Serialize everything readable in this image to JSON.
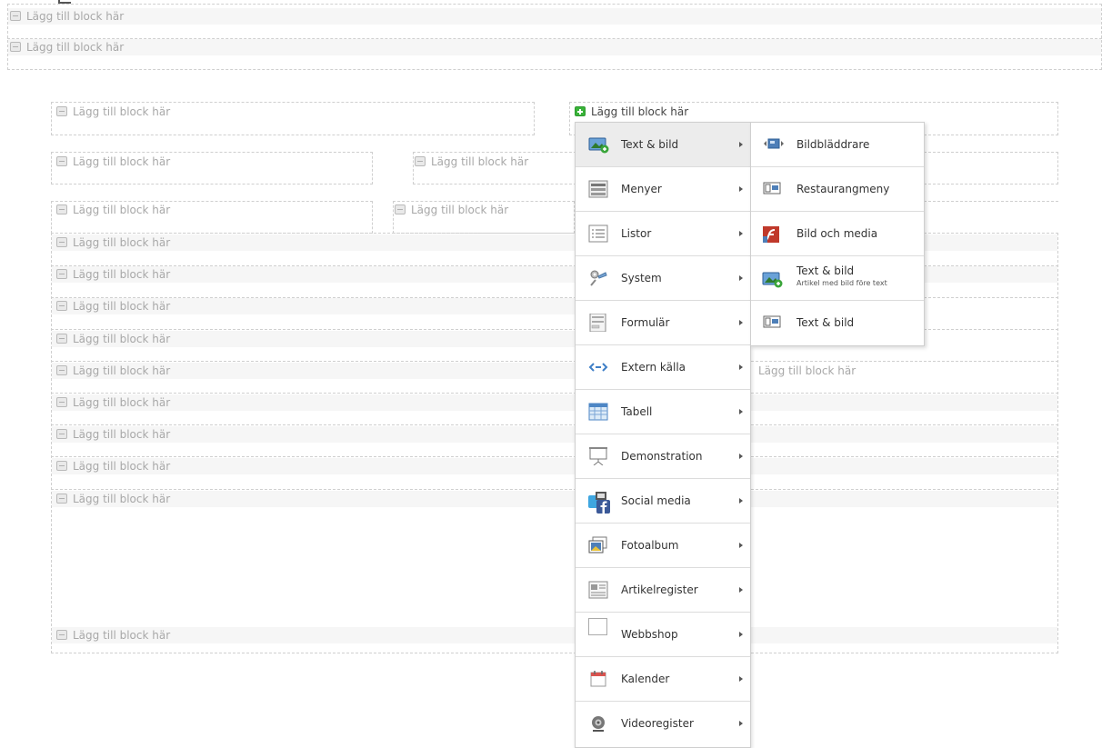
{
  "blocks": {
    "placeholder": "Lägg till block här",
    "active_placeholder": "Lägg till block här"
  },
  "menu": {
    "items": [
      {
        "label": "Text & bild",
        "icon": "text-image-icon"
      },
      {
        "label": "Menyer",
        "icon": "menu-icon"
      },
      {
        "label": "Listor",
        "icon": "list-icon"
      },
      {
        "label": "System",
        "icon": "system-icon"
      },
      {
        "label": "Formulär",
        "icon": "form-icon"
      },
      {
        "label": "Extern källa",
        "icon": "external-source-icon"
      },
      {
        "label": "Tabell",
        "icon": "table-icon"
      },
      {
        "label": "Demonstration",
        "icon": "presentation-icon"
      },
      {
        "label": "Social media",
        "icon": "social-media-icon"
      },
      {
        "label": "Fotoalbum",
        "icon": "photo-album-icon"
      },
      {
        "label": "Artikelregister",
        "icon": "article-register-icon"
      },
      {
        "label": "Webbshop",
        "icon": "webshop-icon"
      },
      {
        "label": "Kalender",
        "icon": "calendar-icon"
      },
      {
        "label": "Videoregister",
        "icon": "video-register-icon"
      }
    ]
  },
  "submenu": {
    "items": [
      {
        "label": "Bildbläddrare",
        "icon": "image-browser-icon"
      },
      {
        "label": "Restaurangmeny",
        "icon": "restaurant-menu-icon"
      },
      {
        "label": "Bild och media",
        "icon": "flash-media-icon"
      },
      {
        "label": "Text & bild",
        "sublabel": "Artikel med bild före text",
        "icon": "text-image-icon"
      },
      {
        "label": "Text & bild",
        "icon": "text-image-small-icon"
      }
    ]
  },
  "colors": {
    "active_icon": "#39b339",
    "menu_selected_bg": "#ececec"
  }
}
